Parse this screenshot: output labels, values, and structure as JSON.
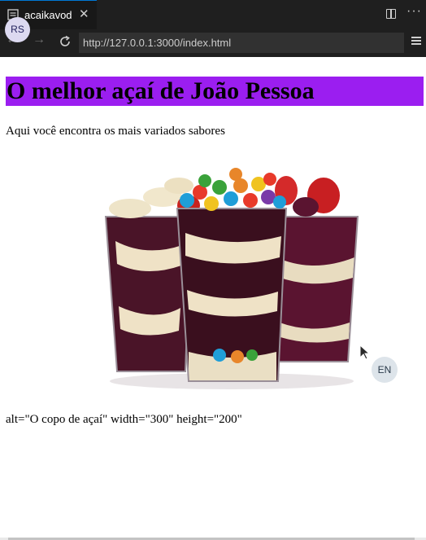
{
  "browser": {
    "tab_title": "acaikavod",
    "tab_close_glyph": "✕",
    "url": "http://127.0.0.1:3000/index.html",
    "back_glyph": "←",
    "forward_glyph": "→",
    "more_glyph": "···",
    "avatar_initials": "RS"
  },
  "page": {
    "heading": "O melhor açaí de João Pessoa",
    "heading_bg": "#9b1ef0",
    "subtitle": "Aqui você encontra os mais variados sabores",
    "image_alt": "açaí cups with candies, strawberries and banana",
    "caption": "alt=\"O copo de açaí\" width=\"300\" height=\"200\""
  },
  "overlay": {
    "language_badge": "EN"
  }
}
